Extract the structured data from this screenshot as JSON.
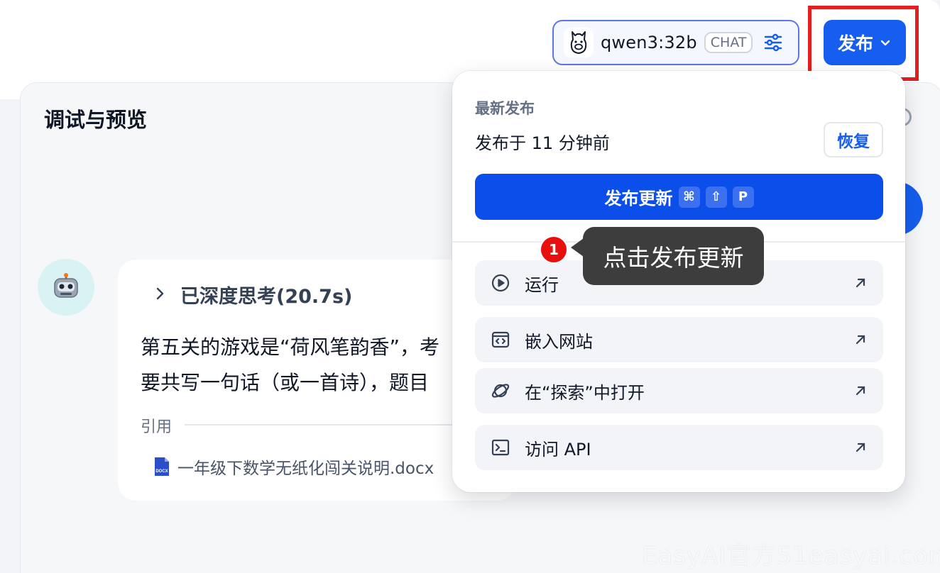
{
  "header": {
    "model": {
      "name": "qwen3:32b",
      "mode_badge": "CHAT",
      "icon": "llama-icon",
      "settings_icon": "sliders-icon"
    },
    "publish_button": {
      "label": "发布",
      "icon": "chevron-down-icon"
    }
  },
  "preview": {
    "title": "调试与预览",
    "message": {
      "avatar_icon": "robot-icon",
      "thinking_label": "已深度思考(20.7s)",
      "lines": [
        "第五关的游戏是“荷风笔韵香”，考",
        "要共写一句话（或一首诗），题目"
      ],
      "reference_label": "引用",
      "reference_file": "一年级下数学无纸化闯关说明.docx"
    }
  },
  "publish_menu": {
    "latest_label": "最新发布",
    "published_time": "发布于 11 分钟前",
    "restore_label": "恢复",
    "update_button": {
      "label": "发布更新",
      "shortcut_keys": [
        "⌘",
        "⇧",
        "P"
      ]
    },
    "items": [
      {
        "label": "运行",
        "icon": "play-circle-icon"
      },
      {
        "label": "嵌入网站",
        "icon": "embed-code-icon"
      },
      {
        "label": "在“探索”中打开",
        "icon": "explore-planet-icon"
      },
      {
        "label": "访问 API",
        "icon": "terminal-icon"
      }
    ]
  },
  "annotation": {
    "step_number": "1",
    "tooltip_text": "点击发布更新"
  },
  "watermark": "EasyAI官方51easyai.com",
  "colors": {
    "primary": "#155eef",
    "highlight_red": "#e0201e",
    "tooltip_bg": "#3d3d3d"
  }
}
